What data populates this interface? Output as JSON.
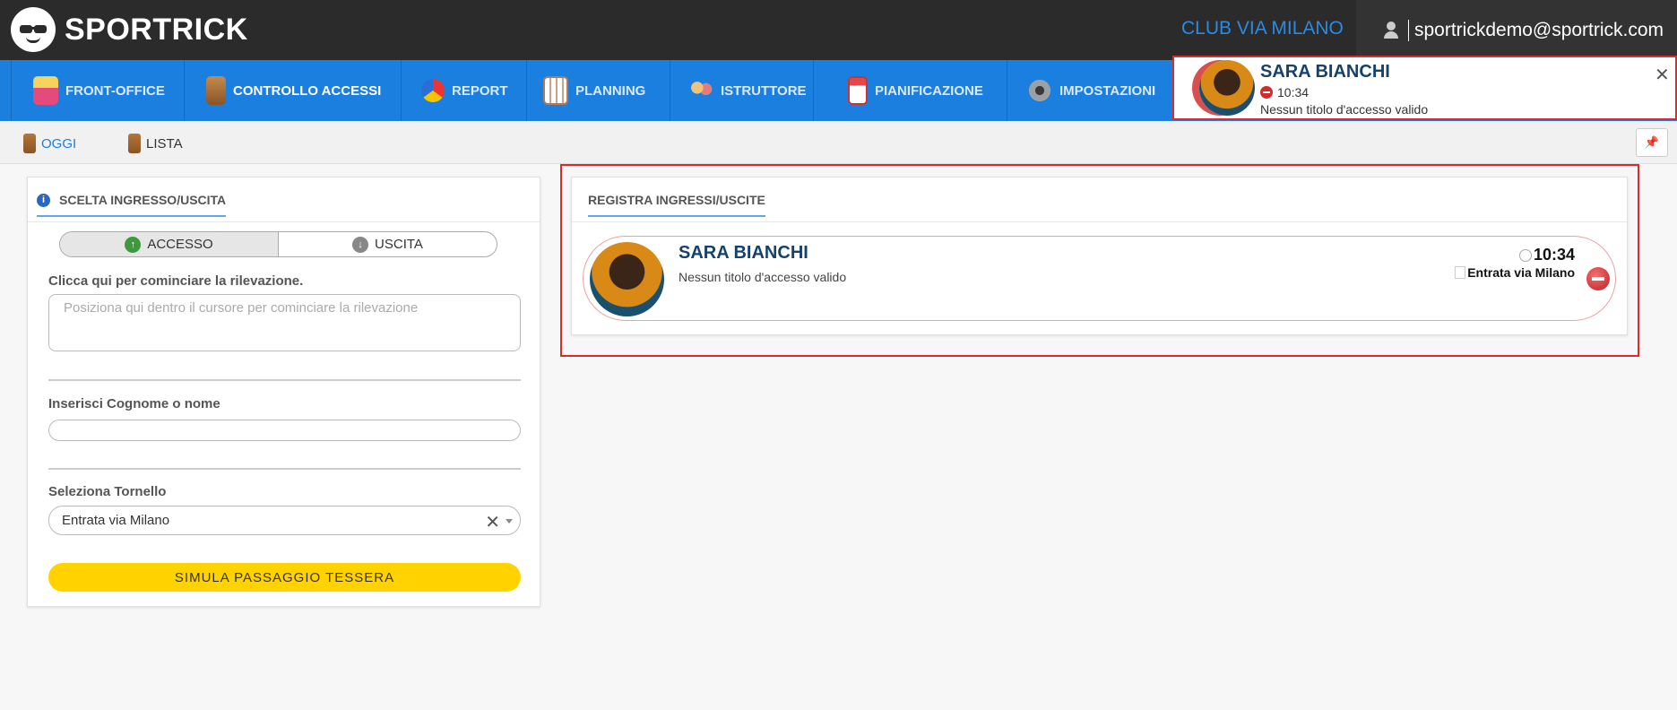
{
  "app": {
    "brand": "SPORTRICK"
  },
  "header": {
    "club": "CLUB VIA MILANO",
    "user_email": "sportrickdemo@sportrick.com"
  },
  "nav": {
    "items": [
      {
        "label": "FRONT-OFFICE",
        "icon": "front-office-person-icon"
      },
      {
        "label": "CONTROLLO ACCESSI",
        "icon": "door-access-icon",
        "active": true
      },
      {
        "label": "REPORT",
        "icon": "pie-chart-icon"
      },
      {
        "label": "PLANNING",
        "icon": "calendar-grid-icon"
      },
      {
        "label": "ISTRUTTORE",
        "icon": "instructors-icon"
      },
      {
        "label": "PIANIFICAZIONE",
        "icon": "calendar-icon"
      },
      {
        "label": "IMPOSTAZIONI",
        "icon": "gear-icon"
      }
    ]
  },
  "notification": {
    "name": "SARA BIANCHI",
    "time": "10:34",
    "message": "Nessun titolo d'accesso valido",
    "close": "✕"
  },
  "subnav": {
    "items": [
      {
        "label": "OGGI",
        "active": true
      },
      {
        "label": "LISTA"
      }
    ],
    "pin": "📌"
  },
  "left_panel": {
    "title": "SCELTA INGRESSO/USCITA",
    "toggle": {
      "access_label": "ACCESSO",
      "exit_label": "USCITA",
      "selected": "ACCESSO"
    },
    "click_label": "Clicca qui per cominciare la rilevazione.",
    "click_placeholder": "Posiziona qui dentro il cursore per cominciare la rilevazione",
    "search_label": "Inserisci Cognome o nome",
    "search_value": "",
    "turnstile_label": "Seleziona Tornello",
    "turnstile_value": "Entrata via Milano",
    "simulate_button": "SIMULA PASSAGGIO TESSERA"
  },
  "right_panel": {
    "title": "REGISTRA INGRESSI/USCITE",
    "record": {
      "name": "SARA BIANCHI",
      "message": "Nessun titolo d'accesso valido",
      "time": "10:34",
      "place": "Entrata via Milano"
    }
  },
  "colors": {
    "topbar": "#2b2b2b",
    "nav": "#1b7fe0",
    "accent": "#2d8ae0",
    "highlight": "#e02a2a",
    "button": "#ffd200"
  }
}
